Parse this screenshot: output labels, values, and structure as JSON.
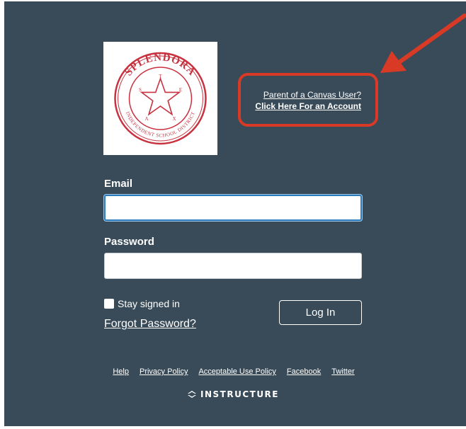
{
  "logo": {
    "name": "SPLENDORA",
    "subtitle": "INDEPENDENT SCHOOL DISTRICT",
    "emblem_letters": [
      "T",
      "E",
      "X",
      "A",
      "S"
    ],
    "colors": {
      "seal": "#c8323f"
    }
  },
  "parent_link": {
    "line1": "Parent of a Canvas User?",
    "line2": "Click Here For an Account"
  },
  "form": {
    "email": {
      "label": "Email",
      "value": "",
      "placeholder": ""
    },
    "password": {
      "label": "Password",
      "value": "",
      "placeholder": ""
    },
    "stay_signed_in": {
      "label": "Stay signed in",
      "checked": false
    },
    "forgot_password": "Forgot Password?",
    "login_button": "Log In"
  },
  "footer": {
    "links": [
      "Help",
      "Privacy Policy",
      "Acceptable Use Policy",
      "Facebook",
      "Twitter"
    ],
    "brand": "INSTRUCTURE"
  },
  "colors": {
    "background": "#394b58",
    "highlight": "#d93a25",
    "focus": "#2b7abc"
  }
}
